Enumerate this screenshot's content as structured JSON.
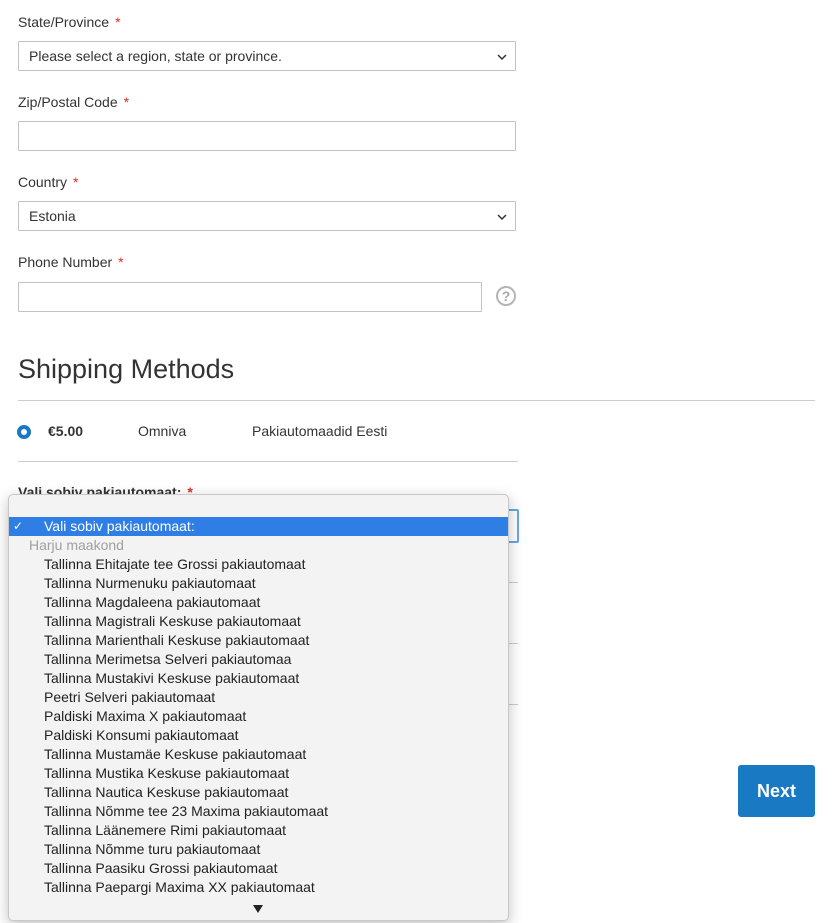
{
  "form": {
    "state": {
      "label": "State/Province",
      "required": "*",
      "value": "Please select a region, state or province."
    },
    "zip": {
      "label": "Zip/Postal Code",
      "required": "*",
      "value": ""
    },
    "country": {
      "label": "Country",
      "required": "*",
      "value": "Estonia"
    },
    "phone": {
      "label": "Phone Number",
      "required": "*",
      "value": "",
      "help": "?"
    }
  },
  "shipping": {
    "title": "Shipping Methods",
    "methods": [
      {
        "price": "€5.00",
        "carrier": "Omniva",
        "method": "Pakiautomaadid Eesti",
        "selected": true
      }
    ],
    "terminal_label": "Vali sobiv pakiautomaat:",
    "terminal_required": "*"
  },
  "dropdown": {
    "selected": "Vali sobiv pakiautomaat:",
    "group": "Harju maakond",
    "options": [
      "Tallinna Ehitajate tee Grossi pakiautomaat",
      "Tallinna Nurmenuku pakiautomaat",
      "Tallinna Magdaleena pakiautomaat",
      "Tallinna Magistrali Keskuse pakiautomaat",
      "Tallinna Marienthali Keskuse pakiautomaat",
      "Tallinna Merimetsa Selveri pakiautomaa",
      "Tallinna Mustakivi Keskuse pakiautomaat",
      "Peetri Selveri pakiautomaat",
      "Paldiski Maxima X pakiautomaat",
      "Paldiski Konsumi pakiautomaat",
      "Tallinna Mustamäe Keskuse pakiautomaat",
      "Tallinna Mustika Keskuse pakiautomaat",
      "Tallinna Nautica Keskuse pakiautomaat",
      "Tallinna Nõmme tee 23 Maxima pakiautomaat",
      "Tallinna Läänemere Rimi pakiautomaat",
      "Tallinna Nõmme turu pakiautomaat",
      "Tallinna Paasiku Grossi pakiautomaat",
      "Tallinna Paepargi Maxima XX pakiautomaat"
    ]
  },
  "actions": {
    "next": "Next"
  },
  "colors": {
    "accent": "#1979c3",
    "required": "#e02b27",
    "selection": "#2f7ee6"
  }
}
